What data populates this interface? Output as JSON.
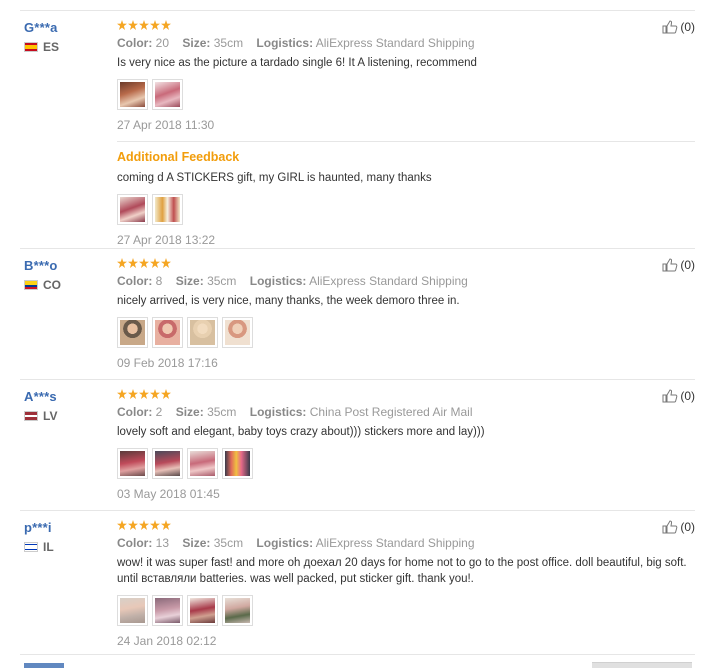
{
  "reviews": [
    {
      "user": "G***a",
      "country": "ES",
      "colors": {
        "flag_top": "#c60b1e",
        "flag_mid": "#ffc400",
        "flag_bot": "#c60b1e"
      },
      "rating": 5,
      "color_label": "Color:",
      "color_value": "20",
      "size_label": "Size:",
      "size_value": "35cm",
      "logistics_label": "Logistics:",
      "logistics_value": "AliExpress Standard Shipping",
      "text": "Is very nice as the picture a tardado single 6! It A listening, recommend",
      "thumbs": 2,
      "date": "27 Apr 2018 11:30",
      "likes": "(0)",
      "additional": {
        "title": "Additional Feedback",
        "text": "coming d A STICKERS gift, my GIRL is haunted, many thanks",
        "thumbs": 2,
        "date": "27 Apr 2018 13:22"
      }
    },
    {
      "user": "B***o",
      "country": "CO",
      "colors": {
        "flag_top": "#fcd116",
        "flag_mid": "#003893",
        "flag_bot": "#ce1126"
      },
      "rating": 5,
      "color_label": "Color:",
      "color_value": "8",
      "size_label": "Size:",
      "size_value": "35cm",
      "logistics_label": "Logistics:",
      "logistics_value": "AliExpress Standard Shipping",
      "text": "nicely arrived, is very nice, many thanks, the week demoro three in.",
      "thumbs": 4,
      "date": "09 Feb 2018 17:16",
      "likes": "(0)"
    },
    {
      "user": "A***s",
      "country": "LV",
      "colors": {
        "flag_top": "#9e3039",
        "flag_mid": "#ffffff",
        "flag_bot": "#9e3039"
      },
      "rating": 5,
      "color_label": "Color:",
      "color_value": "2",
      "size_label": "Size:",
      "size_value": "35cm",
      "logistics_label": "Logistics:",
      "logistics_value": "China Post Registered Air Mail",
      "text": "lovely soft and elegant, baby toys crazy about))) stickers more and lay)))",
      "thumbs": 4,
      "date": "03 May 2018 01:45",
      "likes": "(0)"
    },
    {
      "user": "p***i",
      "country": "IL",
      "colors": {
        "flag_top": "#0038b8",
        "flag_mid": "#ffffff",
        "flag_bot": "#0038b8"
      },
      "rating": 5,
      "color_label": "Color:",
      "color_value": "13",
      "size_label": "Size:",
      "size_value": "35cm",
      "logistics_label": "Logistics:",
      "logistics_value": "AliExpress Standard Shipping",
      "text": "wow! it was super fast! and more oh доехал 20 days for home not to go to the post office. doll beautiful, big soft. until вставляли batteries. was well packed, put sticker gift. thank you!.",
      "thumbs": 4,
      "date": "24 Jan 2018 02:12",
      "likes": "(0)"
    }
  ],
  "icons": {
    "like": "thumbs-up-icon",
    "star": "star-icon"
  },
  "colors_theme": {
    "accent": "#f29d0b",
    "username": "#3a6ab0",
    "star": "#f5a623"
  }
}
